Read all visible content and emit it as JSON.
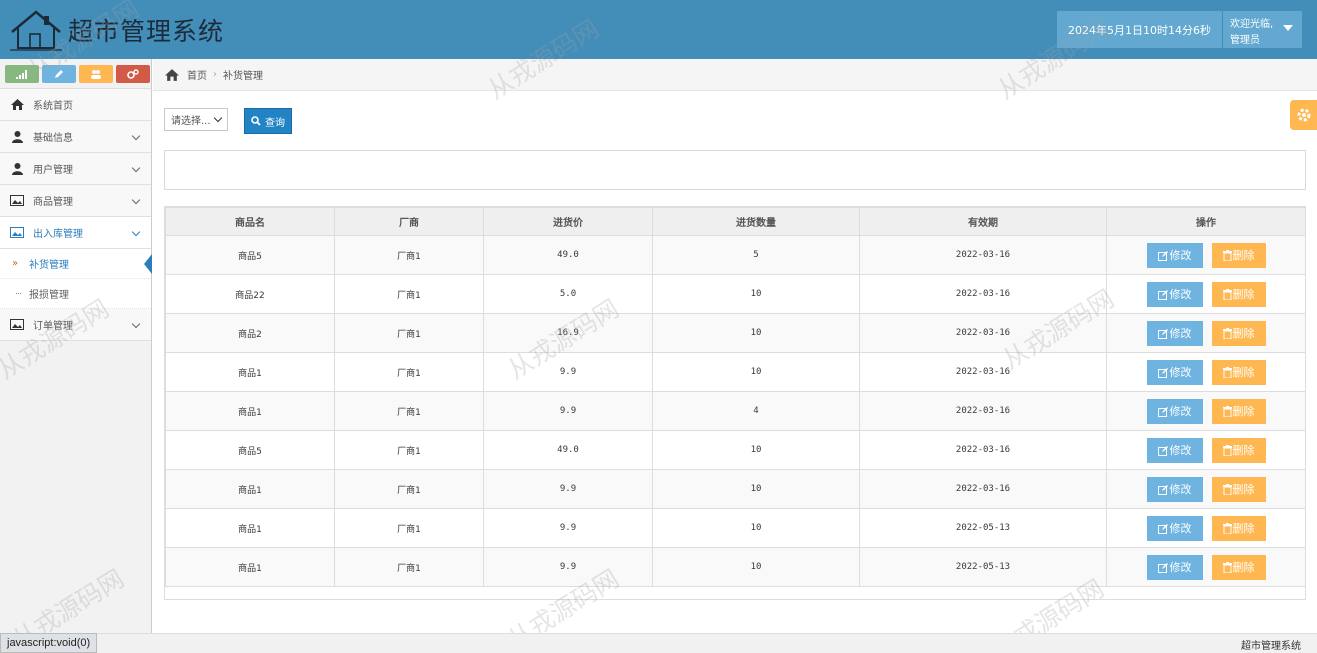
{
  "header": {
    "title": "超市管理系统",
    "datetime": "2024年5月1日10时14分6秒",
    "welcome": "欢迎光临,",
    "role": "管理员"
  },
  "shortcuts": [
    {
      "icon": "signal-icon",
      "color": "#87b87f"
    },
    {
      "icon": "pencil-icon",
      "color": "#6fb3e0"
    },
    {
      "icon": "users-icon",
      "color": "#ffb752"
    },
    {
      "icon": "cogs-icon",
      "color": "#d15b47"
    }
  ],
  "sidebar": {
    "items": [
      {
        "label": "系统首页",
        "icon": "home-icon"
      },
      {
        "label": "基础信息",
        "icon": "user-icon"
      },
      {
        "label": "用户管理",
        "icon": "user-icon"
      },
      {
        "label": "商品管理",
        "icon": "picture-icon"
      },
      {
        "label": "出入库管理",
        "icon": "picture-icon"
      },
      {
        "label": "订单管理",
        "icon": "picture-icon"
      }
    ],
    "subitems": [
      {
        "label": "补货管理",
        "active": true
      },
      {
        "label": "报损管理",
        "active": false
      }
    ]
  },
  "breadcrumb": {
    "home": "首页",
    "current": "补货管理"
  },
  "toolbar": {
    "select_value": "请选择...",
    "search_label": "查询"
  },
  "table": {
    "headers": [
      "商品名",
      "厂商",
      "进货价",
      "进货数量",
      "有效期",
      "操作"
    ],
    "rows": [
      [
        "商品5",
        "厂商1",
        "49.0",
        "5",
        "2022-03-16"
      ],
      [
        "商品22",
        "厂商1",
        "5.0",
        "10",
        "2022-03-16"
      ],
      [
        "商品2",
        "厂商1",
        "16.9",
        "10",
        "2022-03-16"
      ],
      [
        "商品1",
        "厂商1",
        "9.9",
        "10",
        "2022-03-16"
      ],
      [
        "商品1",
        "厂商1",
        "9.9",
        "4",
        "2022-03-16"
      ],
      [
        "商品5",
        "厂商1",
        "49.0",
        "10",
        "2022-03-16"
      ],
      [
        "商品1",
        "厂商1",
        "9.9",
        "10",
        "2022-03-16"
      ],
      [
        "商品1",
        "厂商1",
        "9.9",
        "10",
        "2022-05-13"
      ],
      [
        "商品1",
        "厂商1",
        "9.9",
        "10",
        "2022-05-13"
      ]
    ],
    "edit_label": "修改",
    "delete_label": "删除"
  },
  "footer": {
    "text": "超市管理系统"
  },
  "statusbar": {
    "url": "javascript:void(0)"
  },
  "watermark": "从戎源码网",
  "colors": {
    "header_bg": "#438eb9",
    "edit_button": "#6fb3e0",
    "delete_button": "#ffb752",
    "search_button": "#2283c5"
  }
}
